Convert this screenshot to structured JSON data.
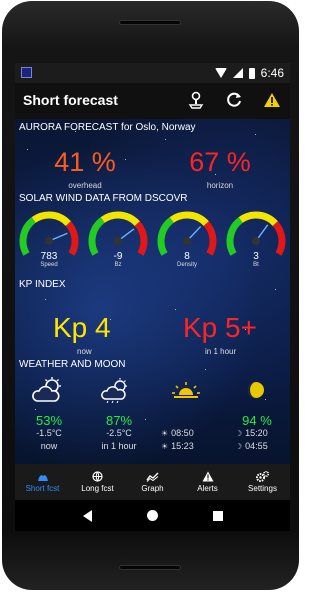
{
  "status_bar": {
    "time": "6:46"
  },
  "app_bar": {
    "title": "Short forecast"
  },
  "aurora": {
    "heading": "AURORA FORECAST for Oslo, Norway",
    "overhead": {
      "value": "41 %",
      "label": "overhead",
      "color": "#ff5a1e"
    },
    "horizon": {
      "value": "67 %",
      "label": "horizon",
      "color": "#ff2424"
    }
  },
  "solar_wind": {
    "heading": "SOLAR WIND DATA FROM DSCOVR",
    "gauges": [
      {
        "value": "783",
        "label": "Speed",
        "level": 0.78
      },
      {
        "value": "-9",
        "label": "Bz",
        "level": 0.72
      },
      {
        "value": "8",
        "label": "Density",
        "level": 0.68
      },
      {
        "value": "3",
        "label": "Bt",
        "level": 0.65
      }
    ]
  },
  "kp": {
    "heading": "KP INDEX",
    "now": {
      "value": "Kp 4",
      "label": "now",
      "color": "#ffe600"
    },
    "later": {
      "value": "Kp 5+",
      "label": "in 1 hour",
      "color": "#ff2424"
    }
  },
  "weather": {
    "heading": "WEATHER AND MOON",
    "now": {
      "pct": "53%",
      "temp": "-1.5°C",
      "when": "now",
      "icon": "partly-cloudy-icon"
    },
    "later": {
      "pct": "87%",
      "temp": "-2.5°C",
      "when": "in 1 hour",
      "icon": "cloudy-sun-icon"
    },
    "sun": {
      "rise": "08:50",
      "set": "15:23",
      "icon": "sunrise-icon"
    },
    "moon": {
      "pct": "94 %",
      "rise": "15:20",
      "set": "04:55",
      "icon": "moon-icon"
    },
    "pct_color": "#22ee44"
  },
  "bottom_nav": {
    "items": [
      {
        "label": "Short fcst",
        "icon": "aurora-icon",
        "active": true
      },
      {
        "label": "Long fcst",
        "icon": "globe-icon",
        "active": false
      },
      {
        "label": "Graph",
        "icon": "graph-icon",
        "active": false
      },
      {
        "label": "Alerts",
        "icon": "alert-icon",
        "active": false
      },
      {
        "label": "Settings",
        "icon": "gears-icon",
        "active": false
      }
    ]
  },
  "colors": {
    "accent": "#2f8dff",
    "warning": "#f5d000"
  }
}
